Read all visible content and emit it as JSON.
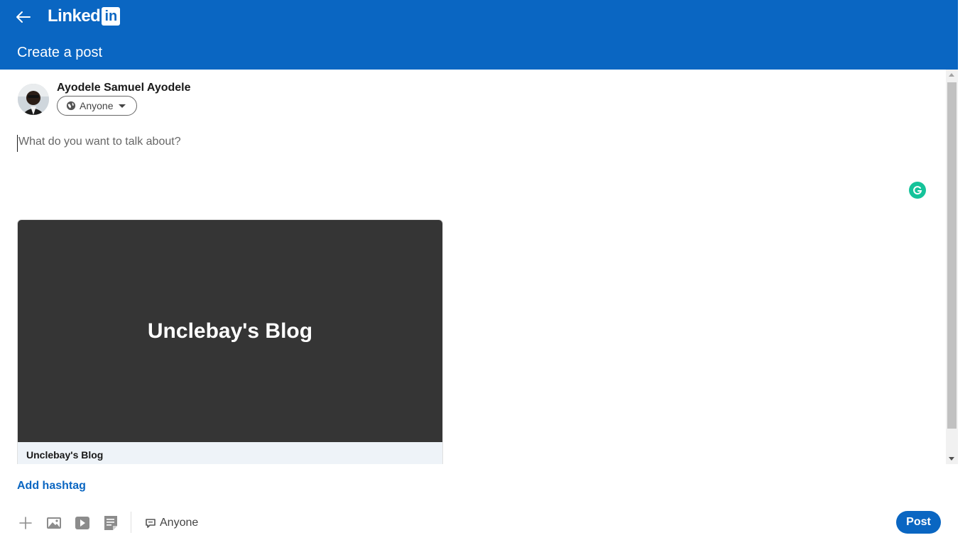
{
  "header": {
    "back_icon": "arrow-left-icon",
    "logo_text": "Linked",
    "logo_box_text": "in",
    "title": "Create a post",
    "bg_color": "#0a66c2"
  },
  "author": {
    "name": "Ayodele Samuel Ayodele",
    "visibility_label": "Anyone",
    "visibility_icon": "globe-icon"
  },
  "composer": {
    "placeholder": "What do you want to talk about?",
    "grammarly_icon": "grammarly-icon"
  },
  "link_preview": {
    "image_text": "Unclebay's Blog",
    "title": "Unclebay's Blog"
  },
  "hashtag": {
    "label": "Add hashtag"
  },
  "toolbar": {
    "icons": [
      "plus-icon",
      "photo-icon",
      "video-icon",
      "document-icon"
    ],
    "comment_control_label": "Anyone",
    "post_label": "Post"
  },
  "colors": {
    "accent": "#0a66c2",
    "preview_bg": "#353535",
    "preview_footer_bg": "#eef3f8",
    "grammarly": "#15c39a"
  }
}
